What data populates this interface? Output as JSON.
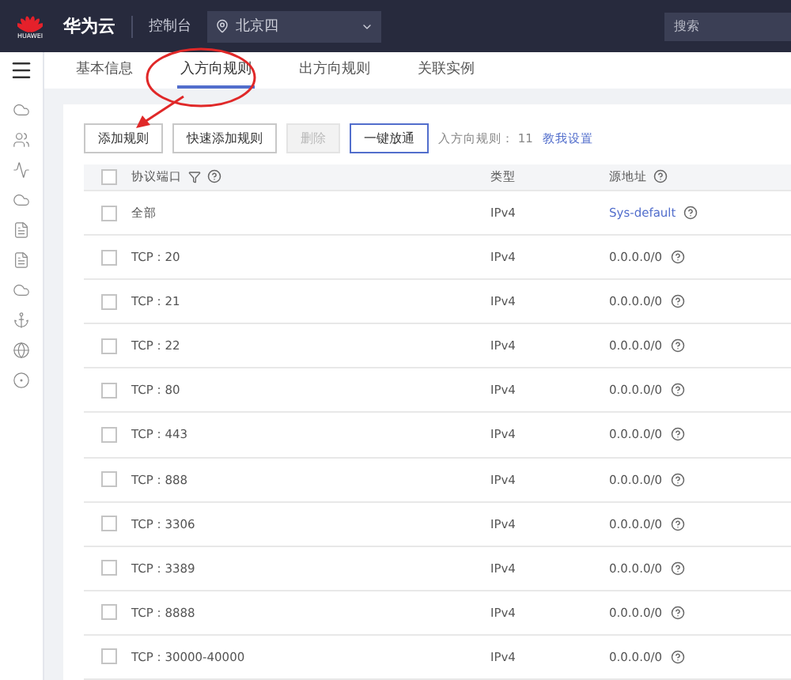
{
  "topbar": {
    "logo_text": "HUAWEI",
    "brand": "华为云",
    "console": "控制台",
    "region": "北京四",
    "search": {
      "placeholder": "搜索"
    }
  },
  "sidebar": {
    "icons": [
      {
        "kind": "menu"
      },
      {
        "kind": "cloud"
      },
      {
        "kind": "cluster"
      },
      {
        "kind": "mountain"
      },
      {
        "kind": "cloud"
      },
      {
        "kind": "doc"
      },
      {
        "kind": "doc"
      },
      {
        "kind": "cloud"
      },
      {
        "kind": "anchor"
      },
      {
        "kind": "globe"
      },
      {
        "kind": "circle"
      }
    ]
  },
  "tabs": [
    {
      "label": "基本信息",
      "selected": false
    },
    {
      "label": "入方向规则",
      "selected": true
    },
    {
      "label": "出方向规则",
      "selected": false
    },
    {
      "label": "关联实例",
      "selected": false
    }
  ],
  "toolbar": {
    "buttons": [
      {
        "label": "添加规则",
        "disabled": false,
        "primary": false
      },
      {
        "label": "快速添加规则",
        "disabled": false,
        "primary": false
      },
      {
        "label": "删除",
        "disabled": true,
        "primary": false
      },
      {
        "label": "一键放通",
        "disabled": false,
        "primary": true
      }
    ],
    "count_label": "入方向规则：",
    "count": "11",
    "link": "教我设置"
  },
  "table": {
    "select_all_checked": false,
    "columns": [
      "协议端口",
      "类型",
      "源地址"
    ],
    "rows": [
      {
        "protocol": "全部",
        "type": "IPv4",
        "source": "Sys-default",
        "source_link": true,
        "checked": false
      },
      {
        "protocol": "TCP : 20",
        "type": "IPv4",
        "source": "0.0.0.0/0",
        "source_link": false,
        "checked": false
      },
      {
        "protocol": "TCP : 21",
        "type": "IPv4",
        "source": "0.0.0.0/0",
        "source_link": false,
        "checked": false
      },
      {
        "protocol": "TCP : 22",
        "type": "IPv4",
        "source": "0.0.0.0/0",
        "source_link": false,
        "checked": false
      },
      {
        "protocol": "TCP : 80",
        "type": "IPv4",
        "source": "0.0.0.0/0",
        "source_link": false,
        "checked": false
      },
      {
        "protocol": "TCP : 443",
        "type": "IPv4",
        "source": "0.0.0.0/0",
        "source_link": false,
        "checked": false
      },
      {
        "protocol": "TCP : 888",
        "type": "IPv4",
        "source": "0.0.0.0/0",
        "source_link": false,
        "checked": false
      },
      {
        "protocol": "TCP : 3306",
        "type": "IPv4",
        "source": "0.0.0.0/0",
        "source_link": false,
        "checked": false
      },
      {
        "protocol": "TCP : 3389",
        "type": "IPv4",
        "source": "0.0.0.0/0",
        "source_link": false,
        "checked": false
      },
      {
        "protocol": "TCP : 8888",
        "type": "IPv4",
        "source": "0.0.0.0/0",
        "source_link": false,
        "checked": false
      },
      {
        "protocol": "TCP : 30000-40000",
        "type": "IPv4",
        "source": "0.0.0.0/0",
        "source_link": false,
        "checked": false
      }
    ]
  }
}
